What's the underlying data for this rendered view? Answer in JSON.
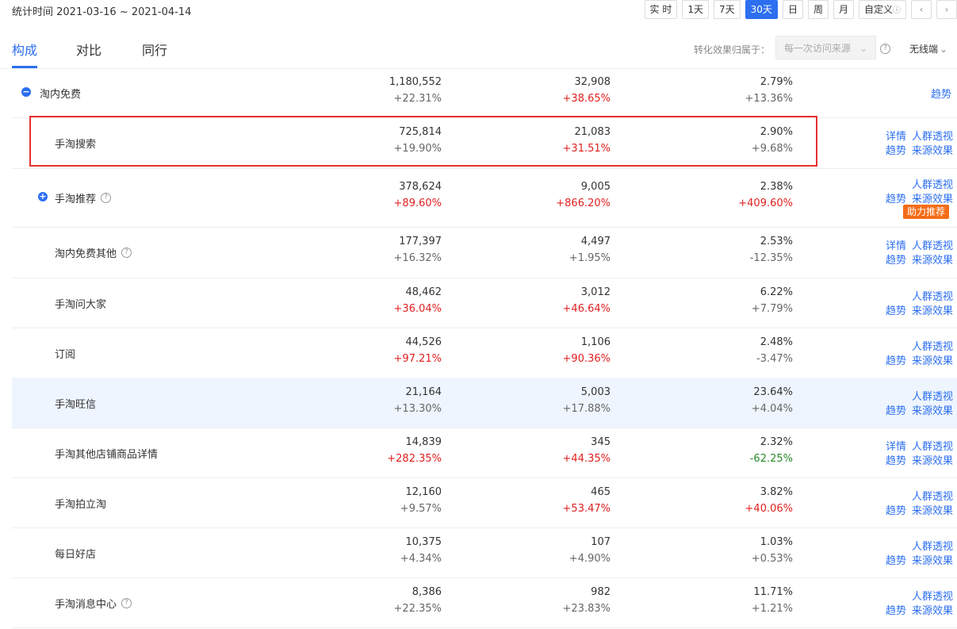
{
  "header": {
    "date_range": "统计时间 2021-03-16 ~ 2021-04-14",
    "time_buttons": [
      "实 时",
      "1天",
      "7天",
      "30天",
      "日",
      "周",
      "月",
      "自定义"
    ],
    "active_time_button": "30天",
    "prev_arrow": "‹",
    "next_arrow": "›"
  },
  "tabs": [
    {
      "label": "构成",
      "active": true
    },
    {
      "label": "对比",
      "active": false
    },
    {
      "label": "同行",
      "active": false
    }
  ],
  "attribution": {
    "label": "转化效果归属于：",
    "select_value": "每一次访问来源",
    "device": "无线端"
  },
  "rows": [
    {
      "name": "淘内免费",
      "toggle": "−",
      "v1": "1,180,552",
      "c1": "+22.31%",
      "v2": "32,908",
      "c2": "+38.65%",
      "v3": "2.79%",
      "c3": "+13.36%",
      "links": [
        "趋势"
      ]
    },
    {
      "name": "手淘搜索",
      "v1": "725,814",
      "c1": "+19.90%",
      "v2": "21,083",
      "c2": "+31.51%",
      "v3": "2.90%",
      "c3": "+9.68%",
      "links": [
        "详情",
        "人群透视",
        "趋势",
        "来源效果"
      ]
    },
    {
      "name": "手淘推荐",
      "toggle": "+",
      "help": true,
      "v1": "378,624",
      "c1": "+89.60%",
      "v2": "9,005",
      "c2": "+866.20%",
      "v3": "2.38%",
      "c3": "+409.60%",
      "links": [
        "人群透视",
        "趋势",
        "来源效果"
      ],
      "badge": "助力推荐"
    },
    {
      "name": "淘内免费其他",
      "help": true,
      "v1": "177,397",
      "c1": "+16.32%",
      "v2": "4,497",
      "c2": "+1.95%",
      "v3": "2.53%",
      "c3": "-12.35%",
      "links": [
        "详情",
        "人群透视",
        "趋势",
        "来源效果"
      ]
    },
    {
      "name": "手淘问大家",
      "v1": "48,462",
      "c1": "+36.04%",
      "v2": "3,012",
      "c2": "+46.64%",
      "v3": "6.22%",
      "c3": "+7.79%",
      "links": [
        "人群透视",
        "趋势",
        "来源效果"
      ]
    },
    {
      "name": "订阅",
      "v1": "44,526",
      "c1": "+97.21%",
      "v2": "1,106",
      "c2": "+90.36%",
      "v3": "2.48%",
      "c3": "-3.47%",
      "links": [
        "人群透视",
        "趋势",
        "来源效果"
      ]
    },
    {
      "name": "手淘旺信",
      "v1": "21,164",
      "c1": "+13.30%",
      "v2": "5,003",
      "c2": "+17.88%",
      "v3": "23.64%",
      "c3": "+4.04%",
      "links": [
        "人群透视",
        "趋势",
        "来源效果"
      ]
    },
    {
      "name": "手淘其他店铺商品详情",
      "v1": "14,839",
      "c1": "+282.35%",
      "v2": "345",
      "c2": "+44.35%",
      "v3": "2.32%",
      "c3": "-62.25%",
      "links": [
        "详情",
        "人群透视",
        "趋势",
        "来源效果"
      ]
    },
    {
      "name": "手淘拍立淘",
      "v1": "12,160",
      "c1": "+9.57%",
      "v2": "465",
      "c2": "+53.47%",
      "v3": "3.82%",
      "c3": "+40.06%",
      "links": [
        "人群透视",
        "趋势",
        "来源效果"
      ]
    },
    {
      "name": "每日好店",
      "v1": "10,375",
      "c1": "+4.34%",
      "v2": "107",
      "c2": "+4.90%",
      "v3": "1.03%",
      "c3": "+0.53%",
      "links": [
        "人群透视",
        "趋势",
        "来源效果"
      ]
    },
    {
      "name": "手淘消息中心",
      "help": true,
      "v1": "8,386",
      "c1": "+22.35%",
      "v2": "982",
      "c2": "+23.83%",
      "v3": "11.71%",
      "c3": "+1.21%",
      "links": [
        "人群透视",
        "趋势",
        "来源效果"
      ]
    }
  ],
  "colors": {
    "accent": "#2c6ff0",
    "up": "#e02020",
    "neutral": "#666666",
    "down": "#2a8a2a",
    "badge": "#f46c18"
  }
}
